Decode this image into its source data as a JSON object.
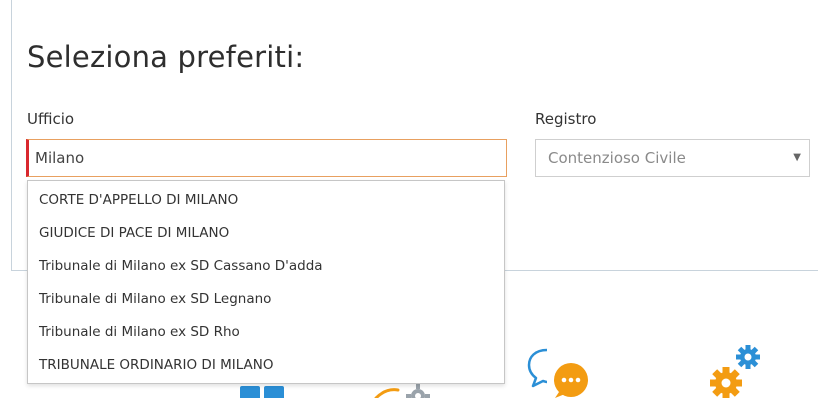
{
  "page": {
    "title": "Seleziona preferiti:"
  },
  "form": {
    "ufficio": {
      "label": "Ufficio",
      "value": "Milano"
    },
    "registro": {
      "label": "Registro",
      "selected": "Contenzioso Civile",
      "caret": "▼"
    }
  },
  "dropdown": {
    "items": [
      "CORTE D'APPELLO DI MILANO",
      "GIUDICE DI PACE DI MILANO",
      "Tribunale di Milano ex SD Cassano D'adda",
      "Tribunale di Milano ex SD Legnano",
      "Tribunale di Milano ex SD Rho",
      "TRIBUNALE ORDINARIO DI MILANO"
    ]
  },
  "icons": {
    "tiles": "tiles-icon",
    "gear_grey": "gear-icon",
    "chat": "chat-bubbles-icon",
    "gears": "gears-icon"
  },
  "colors": {
    "input_focus_border": "#e8a060",
    "input_error_accent": "#d9272e",
    "icon_blue": "#2b8fd6",
    "icon_orange": "#f39c12"
  }
}
